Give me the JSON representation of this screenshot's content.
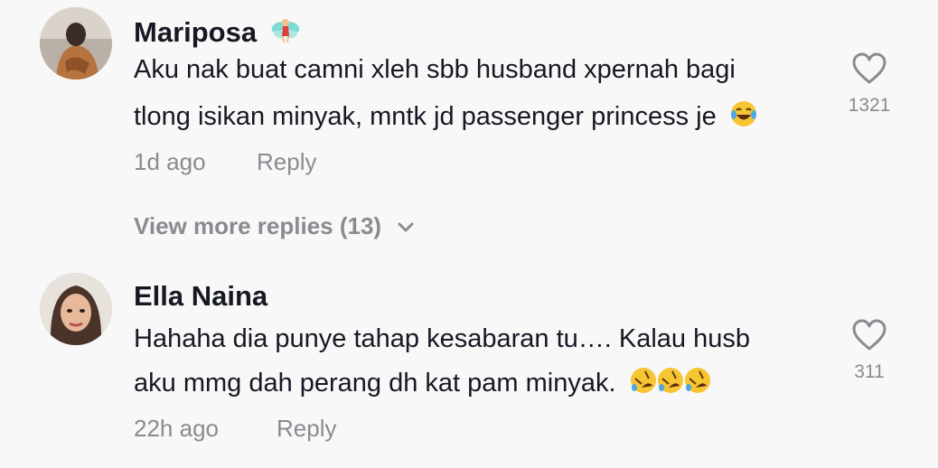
{
  "comments": [
    {
      "username": "Mariposa",
      "username_badge_icon": "fairy-emoji",
      "lines": [
        "Aku nak buat camni xleh sbb husband xpernah bagi",
        "tlong isikan minyak, mntk jd passenger princess je"
      ],
      "line_end_emoji": [
        "laughing-tears-emoji"
      ],
      "time": "1d ago",
      "reply_label": "Reply",
      "like_icon": "heart-outline-icon",
      "like_count": "1321",
      "more_replies_label": "View more replies (13)",
      "more_replies_icon": "chevron-down-icon"
    },
    {
      "username": "Ella Naina",
      "lines": [
        "Hahaha dia punye tahap kesabaran tu…. Kalau husb",
        "aku mmg dah perang dh kat pam minyak."
      ],
      "line_end_emoji": [
        "rolling-laughing-emoji",
        "rolling-laughing-emoji",
        "rolling-laughing-emoji"
      ],
      "time": "22h ago",
      "reply_label": "Reply",
      "like_icon": "heart-outline-icon",
      "like_count": "311"
    }
  ],
  "colors": {
    "background": "#f8f8f8",
    "text_primary": "#161823",
    "text_secondary": "#8a8b91"
  }
}
